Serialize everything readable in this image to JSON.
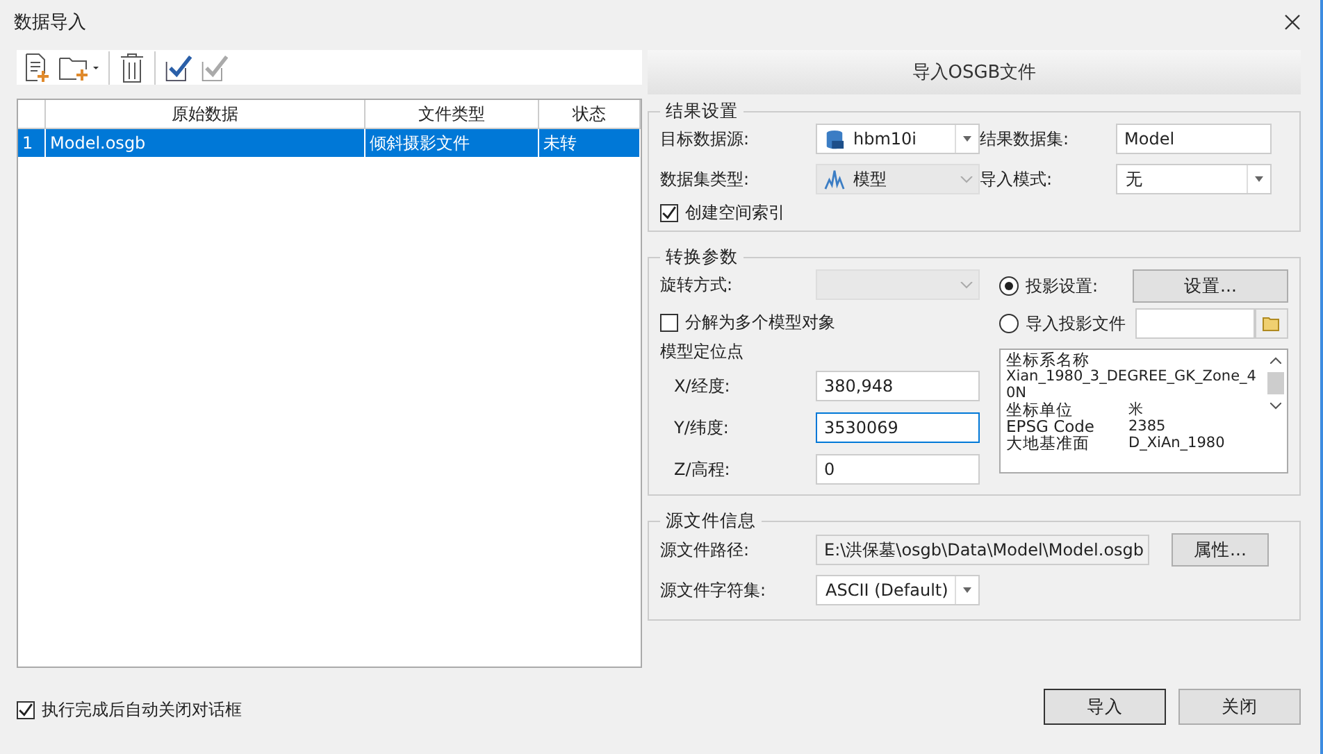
{
  "window": {
    "title": "数据导入"
  },
  "table": {
    "columns": [
      "原始数据",
      "文件类型",
      "状态"
    ],
    "rows": [
      {
        "index": "1",
        "cells": [
          "Model.osgb",
          "倾斜摄影文件",
          "未转"
        ],
        "selected": true
      }
    ]
  },
  "import_tab": "导入OSGB文件",
  "result_settings": {
    "title": "结果设置",
    "target_datasource": {
      "label": "目标数据源:",
      "value": "hbm10i"
    },
    "result_dataset": {
      "label": "结果数据集:",
      "value": "Model"
    },
    "dataset_type": {
      "label": "数据集类型:",
      "value": "模型",
      "disabled": true
    },
    "import_mode": {
      "label": "导入模式:",
      "value": "无"
    },
    "spatial_index": {
      "label": "创建空间索引",
      "checked": true
    }
  },
  "conversion": {
    "title": "转换参数",
    "rotation": {
      "label": "旋转方式:",
      "disabled": true
    },
    "split": {
      "label": "分解为多个模型对象",
      "checked": false
    },
    "anchor_title": "模型定位点",
    "anchor_fields": [
      {
        "label": "X/经度:",
        "value": "380,948",
        "focused": false
      },
      {
        "label": "Y/纬度:",
        "value": "3530069",
        "focused": true
      },
      {
        "label": "Z/高程:",
        "value": "0",
        "focused": false
      }
    ],
    "projection_options": [
      {
        "label": "投影设置:",
        "selected": true,
        "kind": "button"
      },
      {
        "label": "导入投影文件",
        "selected": false,
        "kind": "file"
      }
    ],
    "settings_button": "设置...",
    "projection_info": [
      {
        "kind": "heading",
        "text": "坐标系名称"
      },
      {
        "kind": "text",
        "text": "Xian_1980_3_DEGREE_GK_Zone_40N"
      },
      {
        "kind": "pair",
        "label": "坐标单位",
        "value": "米"
      },
      {
        "kind": "pair",
        "label": "EPSG Code",
        "value": "2385"
      },
      {
        "kind": "pair",
        "label": "大地基准面",
        "value": "D_XiAn_1980"
      }
    ]
  },
  "source": {
    "title": "源文件信息",
    "path": {
      "label": "源文件路径:",
      "value": "E:\\洪保墓\\osgb\\Data\\Model\\Model.osgb"
    },
    "properties_button": "属性...",
    "charset": {
      "label": "源文件字符集:",
      "value": "ASCII (Default)"
    }
  },
  "footer": {
    "auto_close": {
      "label": "执行完成后自动关闭对话框",
      "checked": true
    },
    "buttons": [
      "导入",
      "关闭"
    ]
  }
}
